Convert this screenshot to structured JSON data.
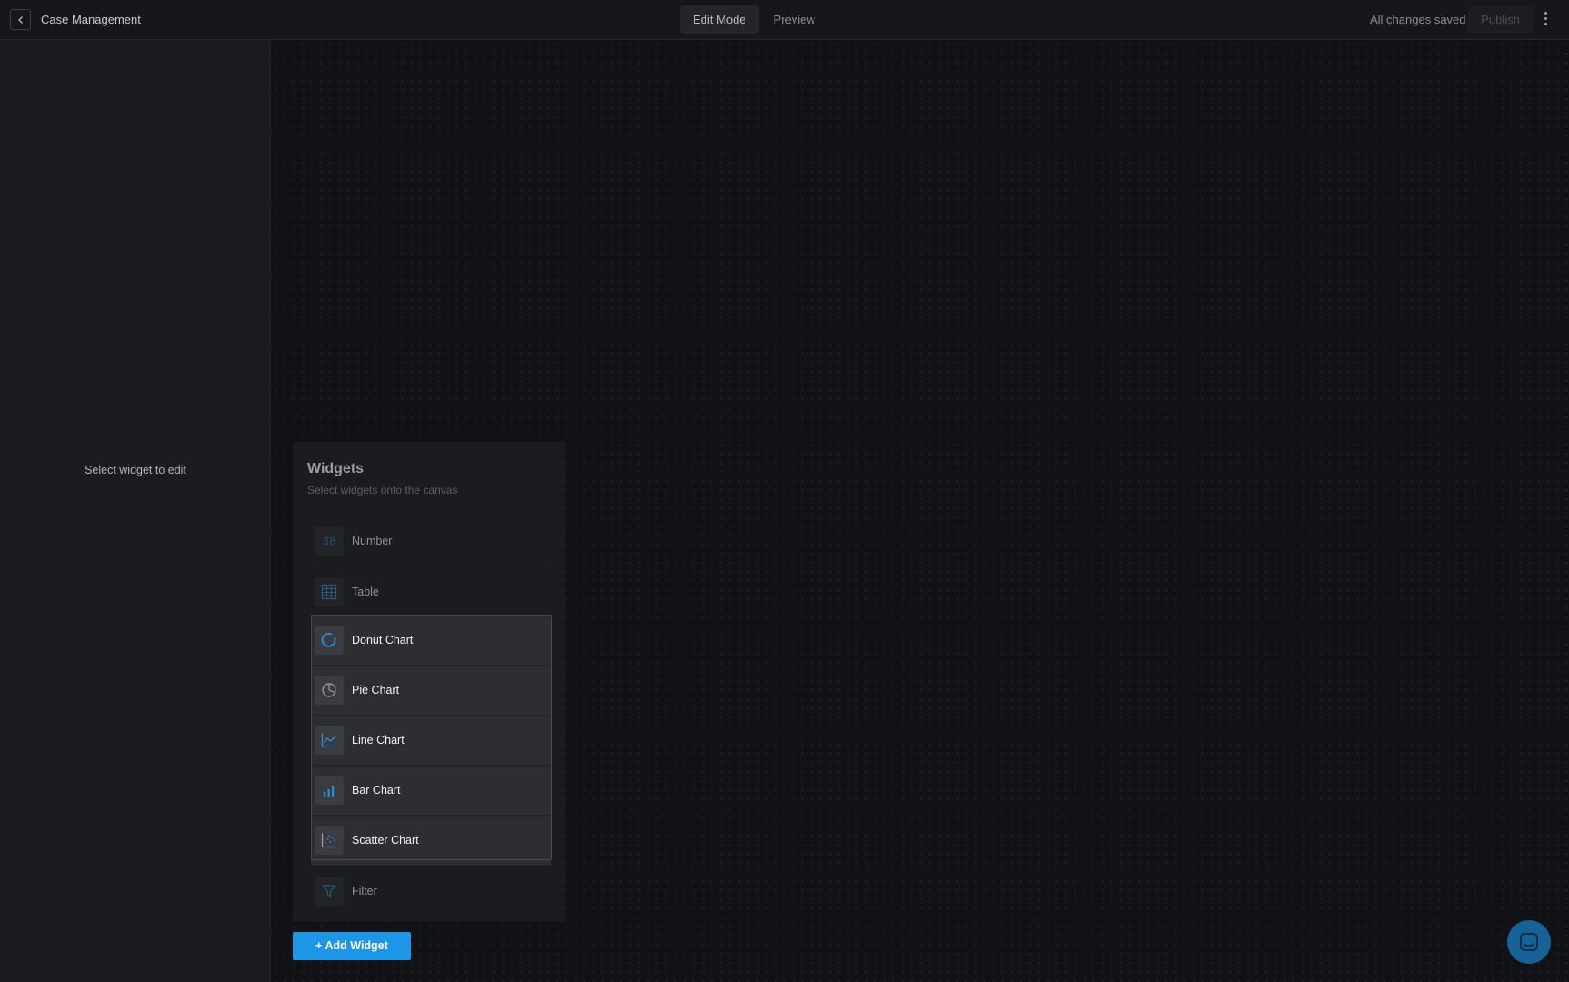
{
  "header": {
    "title": "Case Management",
    "mode_tabs": [
      {
        "label": "Edit Mode",
        "active": true
      },
      {
        "label": "Preview",
        "active": false
      }
    ],
    "save_status": "All changes saved",
    "publish_label": "Publish",
    "icons": {
      "back": "chevron-left-icon",
      "menu": "kebab-menu-icon"
    }
  },
  "left_panel": {
    "hint": "Select widget to edit"
  },
  "widgets_panel": {
    "title": "Widgets",
    "subtitle": "Select widgets onto the canvas",
    "items": [
      {
        "label": "Number",
        "icon": "number-icon",
        "icon_text": "38"
      },
      {
        "label": "Table",
        "icon": "table-icon"
      },
      {
        "label": "Donut Chart",
        "icon": "donut-chart-icon"
      },
      {
        "label": "Pie Chart",
        "icon": "pie-chart-icon"
      },
      {
        "label": "Line Chart",
        "icon": "line-chart-icon"
      },
      {
        "label": "Bar Chart",
        "icon": "bar-chart-icon"
      },
      {
        "label": "Scatter Chart",
        "icon": "scatter-chart-icon"
      },
      {
        "label": "Filter",
        "icon": "filter-icon"
      }
    ]
  },
  "add_widget_label": "+ Add Widget",
  "colors": {
    "accent": "#1e96e6",
    "icon_blue": "#2a8fd6",
    "chat_button": "#166196"
  }
}
